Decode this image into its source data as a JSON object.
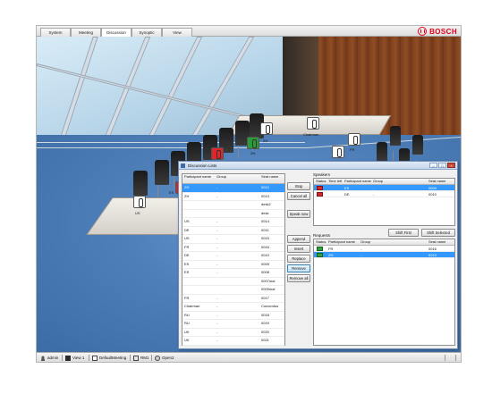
{
  "tabs": [
    "System",
    "Meeting",
    "Discussion",
    "Synoptic",
    "View"
  ],
  "active_tab": "Discussion",
  "brand": {
    "name": "BOSCH",
    "color": "#e3001b"
  },
  "scene": {
    "seat_labels": {
      "chairman": "Chairman",
      "zh": "ZH",
      "de": "DE",
      "uk": "UK",
      "es": "ES",
      "us": "US",
      "fr": "FR"
    }
  },
  "dialog": {
    "title": "Discussion Lists",
    "participant_list": {
      "headers": {
        "name": "Participant name",
        "group": "Group",
        "seat": "Seat name"
      },
      "rows": [
        {
          "name": "ZH",
          "group": "-",
          "seat": "0012",
          "selected": true
        },
        {
          "name": "ZH",
          "group": "-",
          "seat": "0013"
        },
        {
          "name": "",
          "group": "",
          "seat": "desk2"
        },
        {
          "name": "",
          "group": "",
          "seat": "desk"
        },
        {
          "name": "US",
          "group": "-",
          "seat": "0014"
        },
        {
          "name": "DE",
          "group": "-",
          "seat": "0011"
        },
        {
          "name": "US",
          "group": "-",
          "seat": "0015"
        },
        {
          "name": "FR",
          "group": "-",
          "seat": "0016"
        },
        {
          "name": "DE",
          "group": "-",
          "seat": "0010"
        },
        {
          "name": "ES",
          "group": "-",
          "seat": "0009"
        },
        {
          "name": "ES",
          "group": "-",
          "seat": "0008"
        },
        {
          "name": "",
          "group": "",
          "seat": "0007mal"
        },
        {
          "name": "",
          "group": "",
          "seat": "0009mal"
        },
        {
          "name": "FR",
          "group": "-",
          "seat": "0017"
        },
        {
          "name": "Chairman",
          "group": "-",
          "seat": "Concentus"
        },
        {
          "name": "RU",
          "group": "-",
          "seat": "0018"
        },
        {
          "name": "RU",
          "group": "-",
          "seat": "0019"
        },
        {
          "name": "UK",
          "group": "-",
          "seat": "0020"
        },
        {
          "name": "UK",
          "group": "-",
          "seat": "0021"
        }
      ]
    },
    "buttons": {
      "stop": "Stop",
      "cancel_all": "Cancel all",
      "speak_now": "Speak now",
      "append": "Append",
      "insert": "Insert",
      "replace": "Replace",
      "remove": "Remove",
      "remove_all": "Remove all",
      "shift_first": "Shift First",
      "shift_selected": "Shift Selected"
    },
    "speakers": {
      "label": "Speakers",
      "headers": {
        "status": "Status",
        "time_left": "Time left",
        "name": "Participant name",
        "group": "Group",
        "seat": "Seat name"
      },
      "rows": [
        {
          "status": "red",
          "time_left": "",
          "name": "ES",
          "group": "-",
          "seat": "0009",
          "selected": true
        },
        {
          "status": "red",
          "time_left": "",
          "name": "DE",
          "group": "-",
          "seat": "0010"
        }
      ]
    },
    "requests": {
      "label": "Requests",
      "headers": {
        "status": "Status",
        "name": "Participant name",
        "group": "Group",
        "seat": "Seat name"
      },
      "rows": [
        {
          "status": "green",
          "name": "FR",
          "group": "-",
          "seat": "0016"
        },
        {
          "status": "green",
          "name": "ZH",
          "group": "-",
          "seat": "0013",
          "selected": true
        }
      ]
    }
  },
  "statusbar": {
    "user": "admin",
    "view": "View 1",
    "meeting": "DefaultMeeting",
    "code": "RM1",
    "state": "Open2"
  }
}
